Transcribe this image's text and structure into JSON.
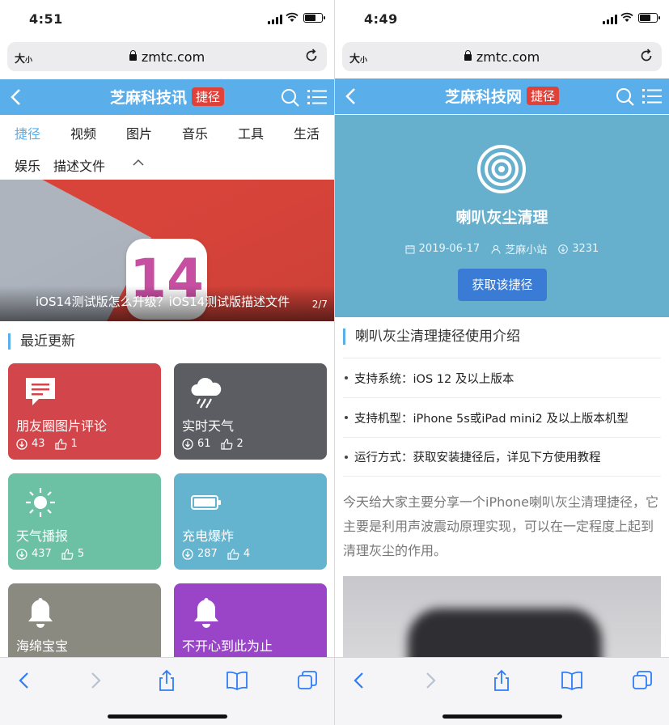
{
  "left": {
    "status": {
      "time": "4:51"
    },
    "address": {
      "text_size": "大",
      "text_size_small": "小",
      "url": "zmtc.com"
    },
    "header": {
      "title": "芝麻科技讯",
      "badge": "捷径"
    },
    "categories_row1": [
      "捷径",
      "视频",
      "图片",
      "音乐",
      "工具",
      "生活"
    ],
    "categories_row2": [
      "娱乐",
      "描述文件"
    ],
    "active_category": "捷径",
    "banner": {
      "icon_text": "14",
      "caption": "iOS14测试版怎么升级？iOS14测试版描述文件",
      "page": "2/7"
    },
    "section_title": "最近更新",
    "cards": [
      {
        "name": "朋友圈图片评论",
        "downloads": "43",
        "likes": "1",
        "color": "#d2454a",
        "icon": "comment-icon"
      },
      {
        "name": "实时天气",
        "downloads": "61",
        "likes": "2",
        "color": "#5c5d62",
        "icon": "cloud-rain-icon"
      },
      {
        "name": "天气播报",
        "downloads": "437",
        "likes": "5",
        "color": "#6cc1a5",
        "icon": "sun-icon"
      },
      {
        "name": "充电爆炸",
        "downloads": "287",
        "likes": "4",
        "color": "#64b4cf",
        "icon": "battery-icon"
      },
      {
        "name": "海绵宝宝",
        "downloads": "",
        "likes": "",
        "color": "#8b8a80",
        "icon": "bell-icon"
      },
      {
        "name": "不开心到此为止",
        "downloads": "",
        "likes": "",
        "color": "#9a45c8",
        "icon": "bell-icon"
      }
    ]
  },
  "right": {
    "status": {
      "time": "4:49"
    },
    "address": {
      "text_size": "大",
      "text_size_small": "小",
      "url": "zmtc.com"
    },
    "header": {
      "title": "芝麻科技网",
      "badge": "捷径"
    },
    "hero": {
      "title": "喇叭灰尘清理",
      "date": "2019-06-17",
      "author": "芝麻小站",
      "downloads": "3231",
      "button": "获取该捷径",
      "color": "#66afcd"
    },
    "intro_title": "喇叭灰尘清理捷径使用介绍",
    "specs": [
      "支持系统：iOS 12 及以上版本",
      "支持机型：iPhone 5s或iPad mini2 及以上版本机型",
      "运行方式：获取安装捷径后，详见下方使用教程"
    ],
    "paragraph": "今天给大家主要分享一个iPhone喇叭灰尘清理捷径，它主要是利用声波震动原理实现，可以在一定程度上起到清理灰尘的作用。"
  },
  "colors": {
    "accent": "#5aaee9",
    "badge": "#e0423a",
    "button": "#3a7bd5",
    "safari_blue": "#2f7cf6"
  }
}
